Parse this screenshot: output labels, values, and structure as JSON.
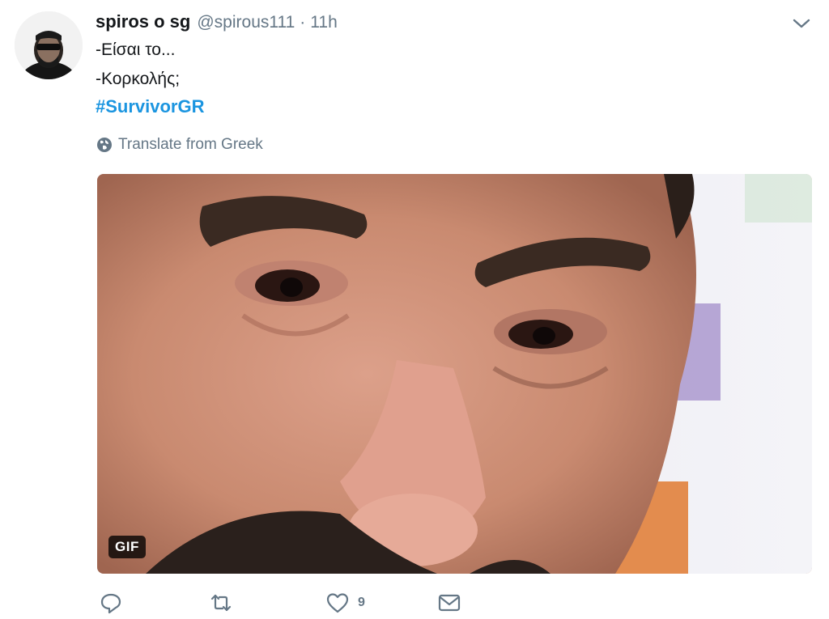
{
  "tweet": {
    "author_name": "spiros o sg",
    "handle": "@spirous111",
    "separator": "·",
    "time": "11h",
    "lines": [
      "-Είσαι το...",
      "-Κορκολής;"
    ],
    "hashtag": "#SurvivorGR",
    "translate_label": "Translate from Greek",
    "media": {
      "badge": "GIF"
    },
    "actions": {
      "reply_icon": "reply-icon",
      "retweet_icon": "retweet-icon",
      "like_icon": "heart-icon",
      "like_count": "9",
      "dm_icon": "envelope-icon"
    }
  },
  "colors": {
    "link": "#1b95e0",
    "secondary_text": "#657786",
    "primary_text": "#14171a",
    "icon": "#657786"
  }
}
